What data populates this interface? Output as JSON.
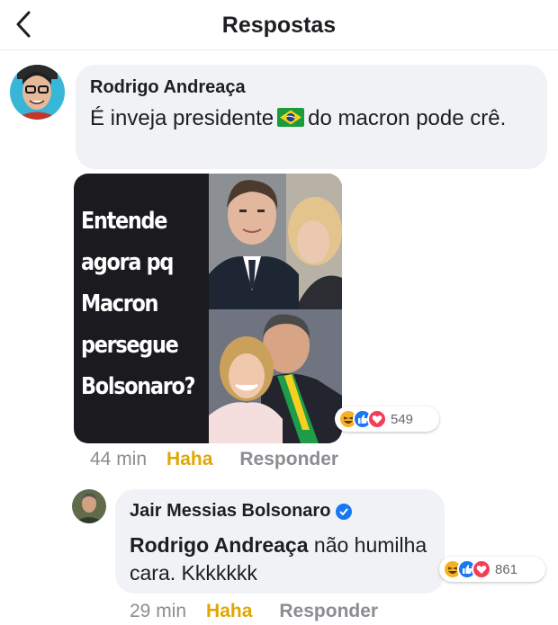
{
  "header": {
    "title": "Respostas"
  },
  "comment": {
    "author": "Rodrigo Andreaça",
    "text_before_flag": "É inveja presidente",
    "text_after_flag": "do macron pode crê.",
    "flag_icon": "brazil-flag-icon",
    "image": {
      "caption": "Entende agora pq Macron persegue Bolsonaro?"
    },
    "reactions": {
      "icons": [
        "haha",
        "like",
        "love"
      ],
      "count": "549"
    },
    "time": "44 min",
    "haha_label": "Haha",
    "reply_label": "Responder"
  },
  "reply": {
    "author": "Jair Messias Bolsonaro",
    "verified": true,
    "mention": "Rodrigo Andreaça",
    "text": "não humilha cara. Kkkkkkk",
    "reactions": {
      "icons": [
        "haha",
        "like",
        "love"
      ],
      "count": "861"
    },
    "time": "29 min",
    "haha_label": "Haha",
    "reply_label": "Responder"
  },
  "colors": {
    "bubble": "#f0f2f5",
    "haha_active": "#e1a600",
    "like_blue": "#1877f2",
    "love_red": "#f33e58",
    "meta_gray": "#8a8d91"
  }
}
